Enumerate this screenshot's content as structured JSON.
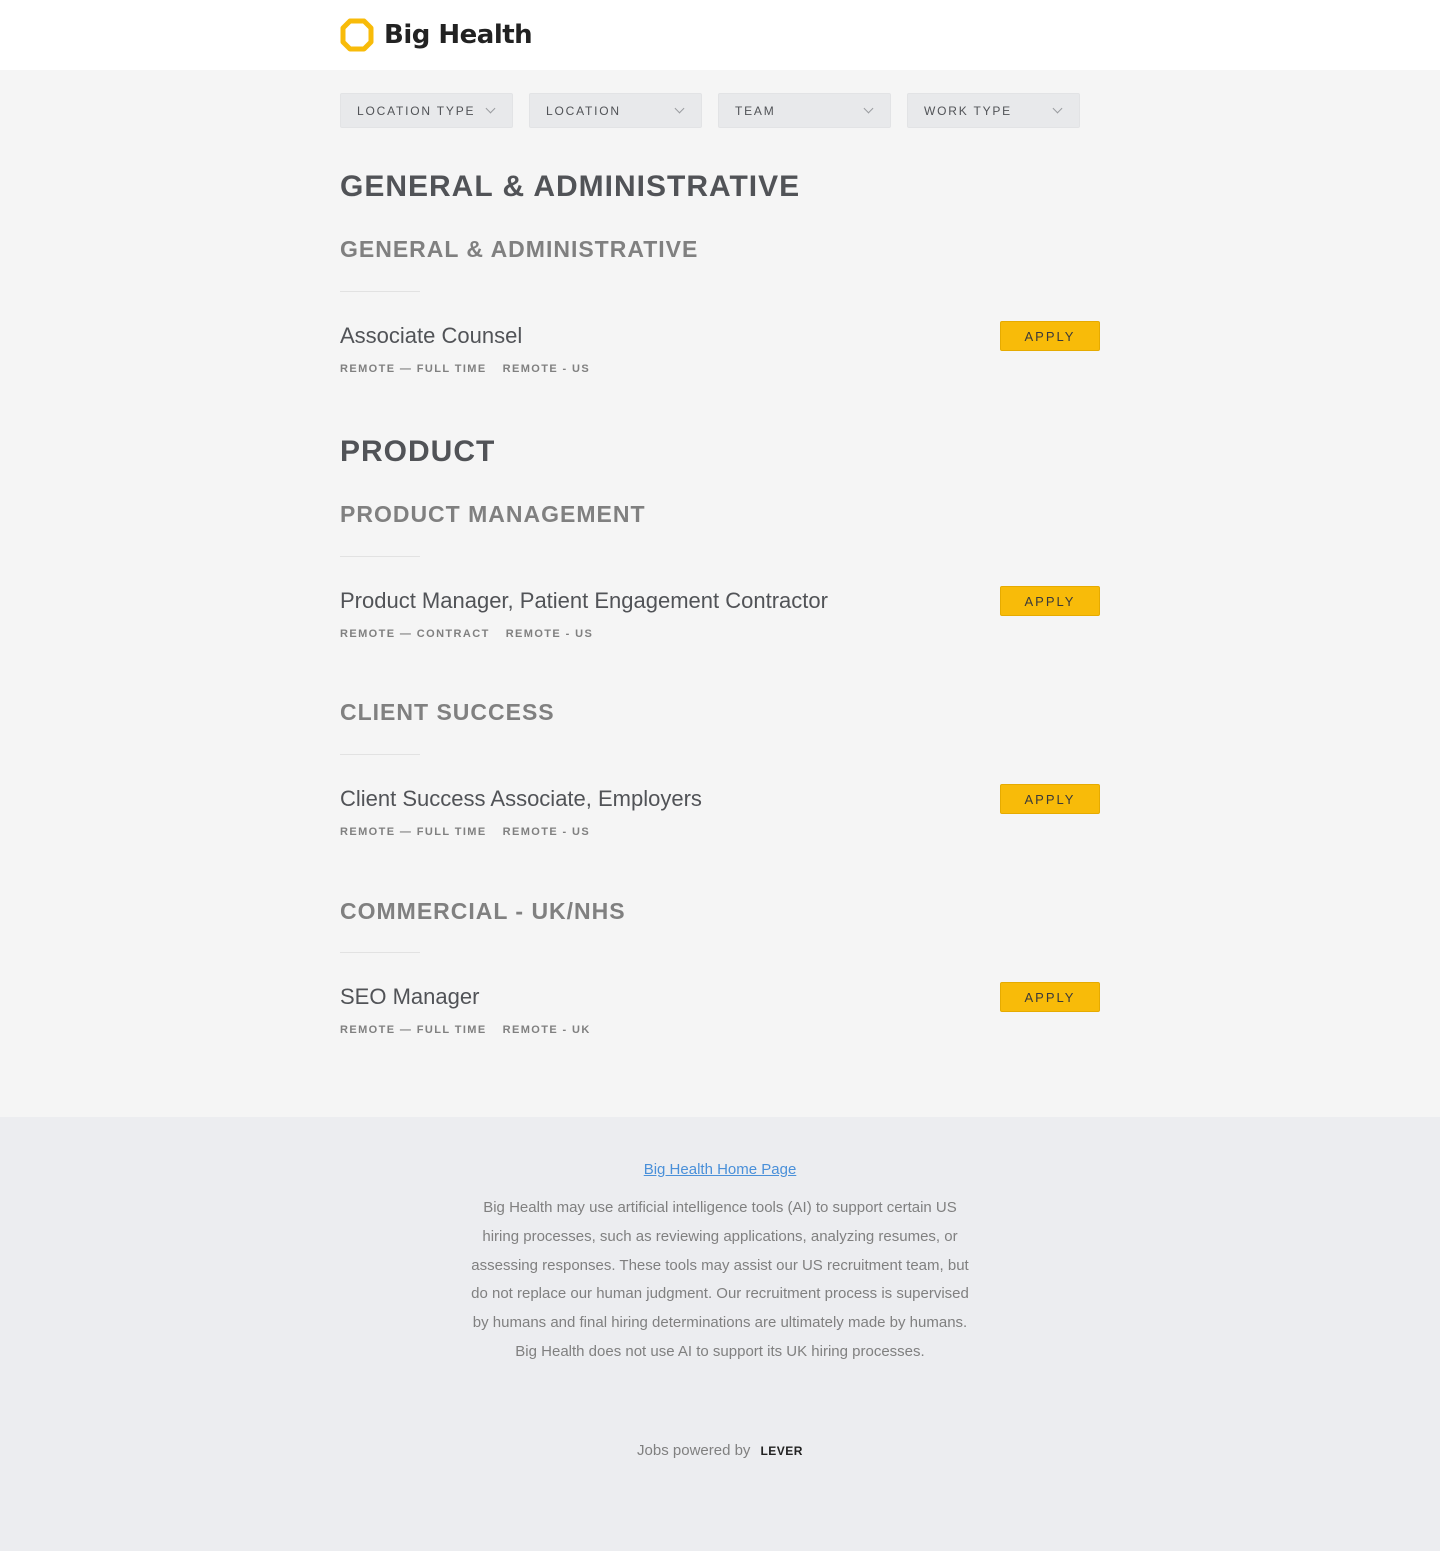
{
  "header": {
    "logo_text": "Big Health",
    "logo_color": "#f8bb09"
  },
  "filters": [
    {
      "label": "LOCATION TYPE"
    },
    {
      "label": "LOCATION"
    },
    {
      "label": "TEAM"
    },
    {
      "label": "WORK TYPE"
    }
  ],
  "departments": [
    {
      "title": "GENERAL & ADMINISTRATIVE",
      "teams": [
        {
          "title": "GENERAL & ADMINISTRATIVE",
          "postings": [
            {
              "title": "Associate Counsel",
              "commitment": "REMOTE — FULL TIME",
              "location": "REMOTE - US",
              "apply_label": "APPLY"
            }
          ]
        }
      ]
    },
    {
      "title": "PRODUCT",
      "teams": [
        {
          "title": "PRODUCT MANAGEMENT",
          "postings": [
            {
              "title": "Product Manager, Patient Engagement Contractor",
              "commitment": "REMOTE — CONTRACT",
              "location": "REMOTE - US",
              "apply_label": "APPLY"
            }
          ]
        },
        {
          "title": "CLIENT SUCCESS",
          "postings": [
            {
              "title": "Client Success Associate, Employers",
              "commitment": "REMOTE — FULL TIME",
              "location": "REMOTE - US",
              "apply_label": "APPLY"
            }
          ]
        },
        {
          "title": "COMMERCIAL - UK/NHS",
          "postings": [
            {
              "title": "SEO Manager",
              "commitment": "REMOTE — FULL TIME",
              "location": "REMOTE - UK",
              "apply_label": "APPLY"
            }
          ]
        }
      ]
    }
  ],
  "footer": {
    "home_link": "Big Health Home Page",
    "disclaimer": "Big Health may use artificial intelligence tools (AI) to support certain US hiring processes, such as reviewing applications, analyzing resumes, or assessing responses. These tools may assist our US recruitment team, but do not replace our human judgment. Our recruitment process is supervised by humans and final hiring determinations are ultimately made by humans. Big Health does not use AI to support its UK hiring processes.",
    "powered_by": "Jobs powered by",
    "lever_logo": "LEVER"
  },
  "colors": {
    "accent": "#f8bb09",
    "link": "#4a90d9",
    "text": "#515357",
    "muted": "#808080"
  }
}
